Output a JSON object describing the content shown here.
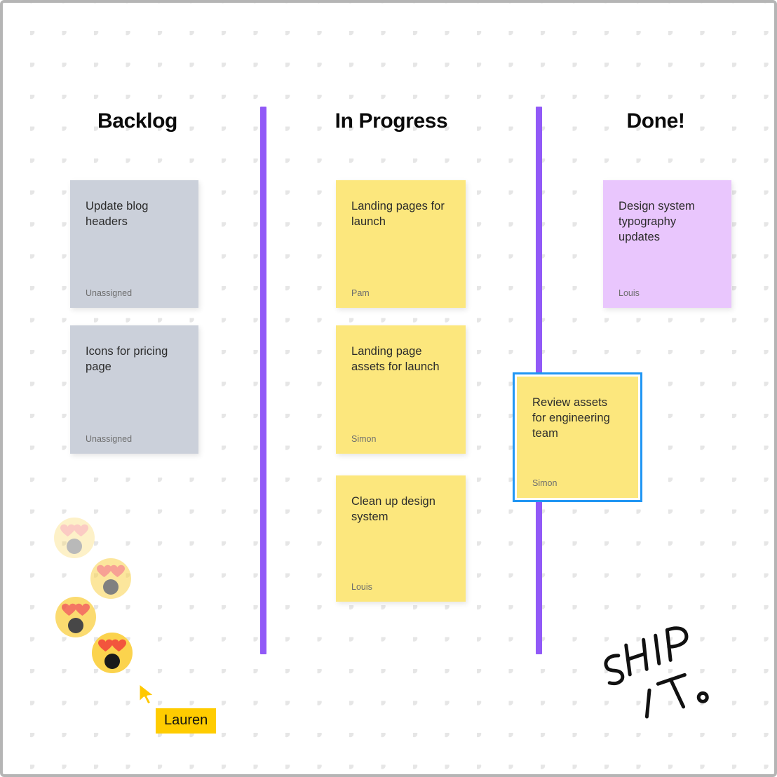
{
  "board": {
    "dot_grid_color": "#e6e6e6",
    "border_color": "#b5b5b5",
    "divider_color": "#9159f7"
  },
  "columns": [
    {
      "id": "backlog",
      "title": "Backlog"
    },
    {
      "id": "in-progress",
      "title": "In Progress"
    },
    {
      "id": "done",
      "title": "Done!"
    }
  ],
  "cards": {
    "update_blog_headers": {
      "title": "Update blog headers",
      "assignee": "Unassigned",
      "color": "#cbd0da"
    },
    "icons_pricing_page": {
      "title": "Icons for pricing page",
      "assignee": "Unassigned",
      "color": "#cbd0da"
    },
    "landing_pages_launch": {
      "title": "Landing pages for launch",
      "assignee": "Pam",
      "color": "#fce77d"
    },
    "landing_page_assets": {
      "title": "Landing page assets for launch",
      "assignee": "Simon",
      "color": "#fce77d"
    },
    "clean_up_design_system": {
      "title": "Clean up design system",
      "assignee": "Louis",
      "color": "#fce77d"
    },
    "design_system_typography": {
      "title": "Design system typography updates",
      "assignee": "Louis",
      "color": "#e9c6fd"
    },
    "review_assets": {
      "title": "Review assets for engineering team",
      "assignee": "Simon",
      "color": "#fce77d",
      "selected": true,
      "selection_color": "#2196f3"
    }
  },
  "cursor": {
    "name": "Lauren",
    "tag_color": "#ffcc00",
    "pointer_color": "#ffc800",
    "icon": "cursor-arrow-icon"
  },
  "reactions": {
    "icon": "heart-eyes-emoji",
    "count": 4,
    "opacities": [
      0.3,
      0.55,
      0.8,
      1.0
    ]
  },
  "sticker": {
    "line1": "SHIP",
    "line2": "IT.",
    "name": "ship-it-sticker"
  }
}
